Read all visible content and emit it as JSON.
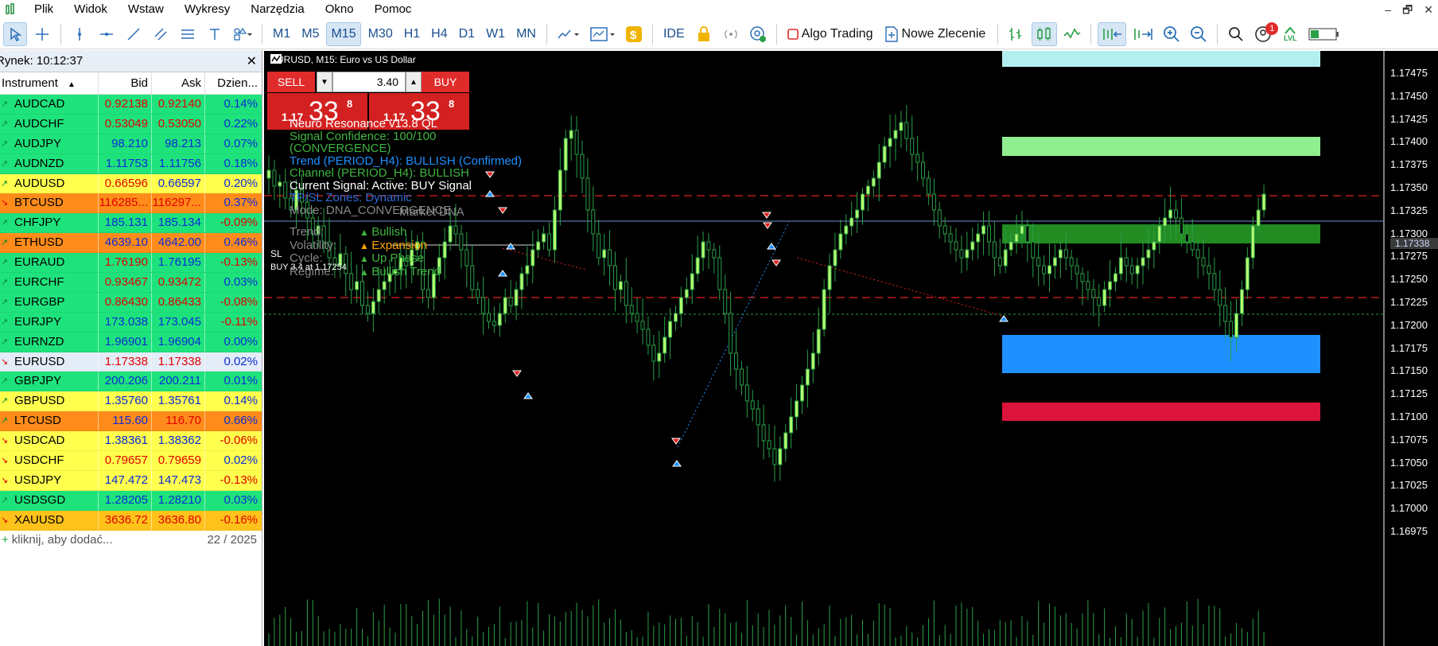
{
  "menubar": {
    "items": [
      "Plik",
      "Widok",
      "Wstaw",
      "Wykresy",
      "Narzędzia",
      "Okno",
      "Pomoc"
    ],
    "win_min": "–",
    "win_restore": "🗗",
    "win_close": "✕"
  },
  "toolbar": {
    "timeframes": [
      "M1",
      "M5",
      "M15",
      "M30",
      "H1",
      "H4",
      "D1",
      "W1",
      "MN"
    ],
    "active_tf": "M15",
    "ide": "IDE",
    "algo": "Algo Trading",
    "order": "Nowe Zlecenie",
    "notif_count": "1",
    "lvl": "LVL"
  },
  "market_watch": {
    "title": "Rynek: 10:12:37",
    "headers": {
      "instrument": "Instrument",
      "bid": "Bid",
      "ask": "Ask",
      "daily": "Dzien..."
    },
    "rows": [
      {
        "sym": "AUDCAD",
        "bid": "0.92138",
        "ask": "0.92140",
        "chg": "0.14%",
        "bg": "#1ee37c",
        "bid_c": "red",
        "ask_c": "red",
        "chg_c": "blue",
        "arrow": "up"
      },
      {
        "sym": "AUDCHF",
        "bid": "0.53049",
        "ask": "0.53050",
        "chg": "0.22%",
        "bg": "#1ee37c",
        "bid_c": "red",
        "ask_c": "red",
        "chg_c": "blue",
        "arrow": "up"
      },
      {
        "sym": "AUDJPY",
        "bid": "98.210",
        "ask": "98.213",
        "chg": "0.07%",
        "bg": "#1ee37c",
        "bid_c": "blue",
        "ask_c": "blue",
        "chg_c": "blue",
        "arrow": "up"
      },
      {
        "sym": "AUDNZD",
        "bid": "1.11753",
        "ask": "1.11756",
        "chg": "0.18%",
        "bg": "#1ee37c",
        "bid_c": "blue",
        "ask_c": "blue",
        "chg_c": "blue",
        "arrow": "up"
      },
      {
        "sym": "AUDUSD",
        "bid": "0.66596",
        "ask": "0.66597",
        "chg": "0.20%",
        "bg": "#ffff4d",
        "bid_c": "red",
        "ask_c": "blue",
        "chg_c": "blue",
        "arrow": "up"
      },
      {
        "sym": "BTCUSD",
        "bid": "116285...",
        "ask": "116297...",
        "chg": "0.37%",
        "bg": "#ff8c1a",
        "bid_c": "red",
        "ask_c": "red",
        "chg_c": "blue",
        "arrow": "down"
      },
      {
        "sym": "CHFJPY",
        "bid": "185.131",
        "ask": "185.134",
        "chg": "-0.09%",
        "bg": "#1ee37c",
        "bid_c": "blue",
        "ask_c": "blue",
        "chg_c": "red",
        "arrow": "up"
      },
      {
        "sym": "ETHUSD",
        "bid": "4639.10",
        "ask": "4642.00",
        "chg": "0.46%",
        "bg": "#ff8c1a",
        "bid_c": "blue",
        "ask_c": "blue",
        "chg_c": "blue",
        "arrow": "up"
      },
      {
        "sym": "EURAUD",
        "bid": "1.76190",
        "ask": "1.76195",
        "chg": "-0.13%",
        "bg": "#1ee37c",
        "bid_c": "red",
        "ask_c": "blue",
        "chg_c": "red",
        "arrow": "up"
      },
      {
        "sym": "EURCHF",
        "bid": "0.93467",
        "ask": "0.93472",
        "chg": "0.03%",
        "bg": "#1ee37c",
        "bid_c": "red",
        "ask_c": "red",
        "chg_c": "blue",
        "arrow": "up"
      },
      {
        "sym": "EURGBP",
        "bid": "0.86430",
        "ask": "0.86433",
        "chg": "-0.08%",
        "bg": "#1ee37c",
        "bid_c": "red",
        "ask_c": "red",
        "chg_c": "red",
        "arrow": "up"
      },
      {
        "sym": "EURJPY",
        "bid": "173.038",
        "ask": "173.045",
        "chg": "-0.11%",
        "bg": "#1ee37c",
        "bid_c": "blue",
        "ask_c": "blue",
        "chg_c": "red",
        "arrow": "up"
      },
      {
        "sym": "EURNZD",
        "bid": "1.96901",
        "ask": "1.96904",
        "chg": "0.00%",
        "bg": "#1ee37c",
        "bid_c": "blue",
        "ask_c": "blue",
        "chg_c": "blue",
        "arrow": "up"
      },
      {
        "sym": "EURUSD",
        "bid": "1.17338",
        "ask": "1.17338",
        "chg": "0.02%",
        "bg": "#e4ecf7",
        "bid_c": "red",
        "ask_c": "red",
        "chg_c": "blue",
        "arrow": "down"
      },
      {
        "sym": "GBPJPY",
        "bid": "200.206",
        "ask": "200.211",
        "chg": "0.01%",
        "bg": "#1ee37c",
        "bid_c": "blue",
        "ask_c": "blue",
        "chg_c": "blue",
        "arrow": "up"
      },
      {
        "sym": "GBPUSD",
        "bid": "1.35760",
        "ask": "1.35761",
        "chg": "0.14%",
        "bg": "#ffff4d",
        "bid_c": "blue",
        "ask_c": "blue",
        "chg_c": "blue",
        "arrow": "up"
      },
      {
        "sym": "LTCUSD",
        "bid": "115.60",
        "ask": "116.70",
        "chg": "0.66%",
        "bg": "#ff8c1a",
        "bid_c": "blue",
        "ask_c": "red",
        "chg_c": "blue",
        "arrow": "up"
      },
      {
        "sym": "USDCAD",
        "bid": "1.38361",
        "ask": "1.38362",
        "chg": "-0.06%",
        "bg": "#ffff4d",
        "bid_c": "blue",
        "ask_c": "blue",
        "chg_c": "red",
        "arrow": "down"
      },
      {
        "sym": "USDCHF",
        "bid": "0.79657",
        "ask": "0.79659",
        "chg": "0.02%",
        "bg": "#ffff4d",
        "bid_c": "red",
        "ask_c": "red",
        "chg_c": "blue",
        "arrow": "down"
      },
      {
        "sym": "USDJPY",
        "bid": "147.472",
        "ask": "147.473",
        "chg": "-0.13%",
        "bg": "#ffff4d",
        "bid_c": "blue",
        "ask_c": "blue",
        "chg_c": "red",
        "arrow": "down"
      },
      {
        "sym": "USDSGD",
        "bid": "1.28205",
        "ask": "1.28210",
        "chg": "0.03%",
        "bg": "#1ee37c",
        "bid_c": "blue",
        "ask_c": "blue",
        "chg_c": "blue",
        "arrow": "up"
      },
      {
        "sym": "XAUUSD",
        "bid": "3636.72",
        "ask": "3636.80",
        "chg": "-0.16%",
        "bg": "#ffc21a",
        "bid_c": "red",
        "ask_c": "red",
        "chg_c": "red",
        "arrow": "down"
      }
    ],
    "footer_add": "kliknij, aby dodać...",
    "footer_count": "22 / 2025"
  },
  "chart": {
    "title": "EURUSD, M15:  Euro vs US Dollar",
    "sell": "SELL",
    "buy": "BUY",
    "volume": "3.40",
    "sell_p1": "1.17",
    "sell_p2": "33",
    "sell_p3": "8",
    "buy_p1": "1.17",
    "buy_p2": "33",
    "buy_p3": "8",
    "panel": {
      "l1": "Neuro Resonance v13.8 QL",
      "l2": "Signal Confidence: 100/100",
      "l3": "(CONVERGENCE)",
      "l4": "Trend (PERIOD_H4): BULLISH (Confirmed)",
      "l5": "Channel (PERIOD_H4): BULLISH",
      "l6": "Current Signal: Active: BUY Signal",
      "l7": "TP/SL Zones: Dynamic",
      "l8": "Mode: DNA_CONVERGENCE",
      "dna": "Market DNA",
      "trend": "Trend:",
      "trend_v": "Bullish",
      "vol": "Volatility:",
      "vol_v": "Expansion",
      "cycle": "Cycle:",
      "cycle_v": "Up Phase",
      "regime": "Regime:",
      "regime_v": "Bullish Trend"
    },
    "sl_label": "SL",
    "buy_label": "BUY 3.4 at 1.17254",
    "current_price": "1.17338",
    "yaxis": [
      "1.17475",
      "1.17450",
      "1.17425",
      "1.17400",
      "1.17375",
      "1.17350",
      "1.17325",
      "1.17300",
      "1.17275",
      "1.17250",
      "1.17225",
      "1.17200",
      "1.17175",
      "1.17150",
      "1.17125",
      "1.17100",
      "1.17075",
      "1.17050",
      "1.17025",
      "1.17000",
      "1.16975"
    ],
    "colors": {
      "bull": "#b8ff6e",
      "zone_cyan": "#b4eff0",
      "zone_lg": "#90ee90",
      "zone_g": "#228b22",
      "zone_b": "#1e90ff",
      "zone_r": "#dc143c"
    }
  }
}
